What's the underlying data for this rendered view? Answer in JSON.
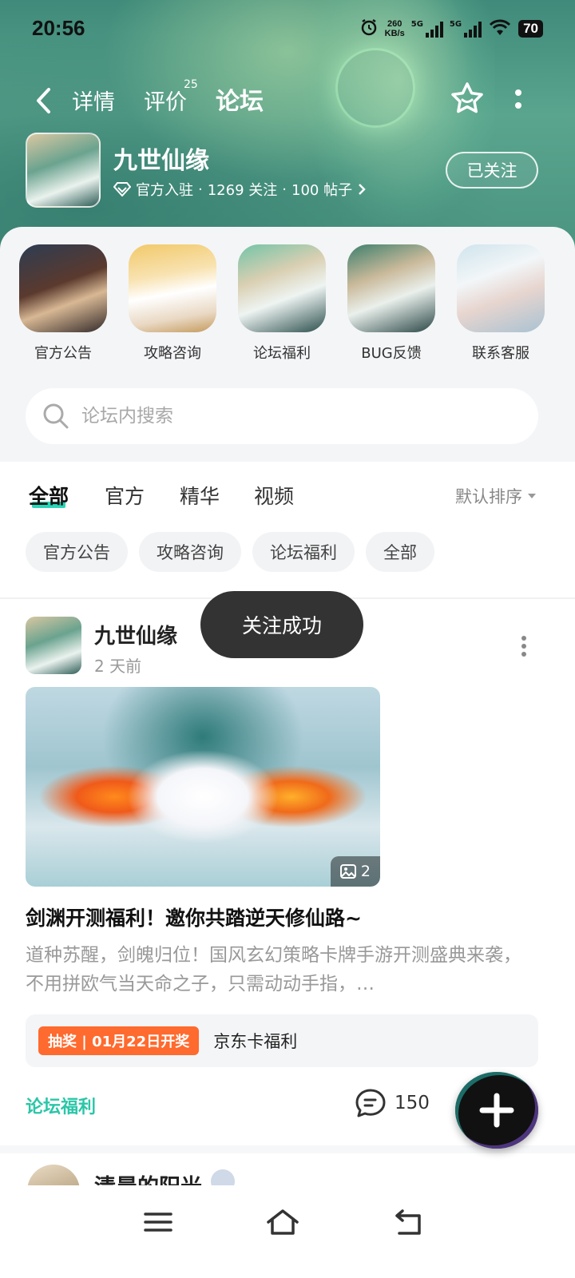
{
  "status_bar": {
    "time": "20:56",
    "net_speed_value": "260",
    "net_speed_unit": "KB/s",
    "sim1": "5G",
    "sim2": "5G",
    "battery": "70"
  },
  "nav": {
    "tabs": [
      {
        "label": "详情"
      },
      {
        "label": "评价",
        "badge": "25"
      },
      {
        "label": "论坛",
        "active": true
      }
    ]
  },
  "game": {
    "name": "九世仙缘",
    "verified": "官方入驻",
    "followers": "1269 关注",
    "posts": "100 帖子",
    "separator": "·",
    "follow_label": "已关注"
  },
  "shortcuts": [
    {
      "label": "官方公告"
    },
    {
      "label": "攻略咨询"
    },
    {
      "label": "论坛福利"
    },
    {
      "label": "BUG反馈"
    },
    {
      "label": "联系客服"
    }
  ],
  "search": {
    "placeholder": "论坛内搜索"
  },
  "filter_tabs": [
    {
      "label": "全部",
      "active": true
    },
    {
      "label": "官方"
    },
    {
      "label": "精华"
    },
    {
      "label": "视频"
    }
  ],
  "sort": {
    "label": "默认排序"
  },
  "chips": [
    "官方公告",
    "攻略咨询",
    "论坛福利",
    "全部"
  ],
  "toast": "关注成功",
  "post": {
    "author": "九世仙缘",
    "time": "2 天前",
    "image_count": "2",
    "title": "剑渊开测福利！邀你共踏逆天修仙路~",
    "excerpt": "道种苏醒，剑魄归位！国风玄幻策略卡牌手游开测盛典来袭，不用拼欧气当天命之子，只需动动手指，…",
    "lottery_badge": "抽奖 | 01月22日开奖",
    "lottery_text": "京东卡福利",
    "category": "论坛福利",
    "comments": "150"
  },
  "next_post": {
    "author": "清晨的阳光"
  },
  "colors": {
    "accent": "#2ad5b8",
    "category": "#2ac6a8",
    "lottery": "#ff6a2e"
  }
}
